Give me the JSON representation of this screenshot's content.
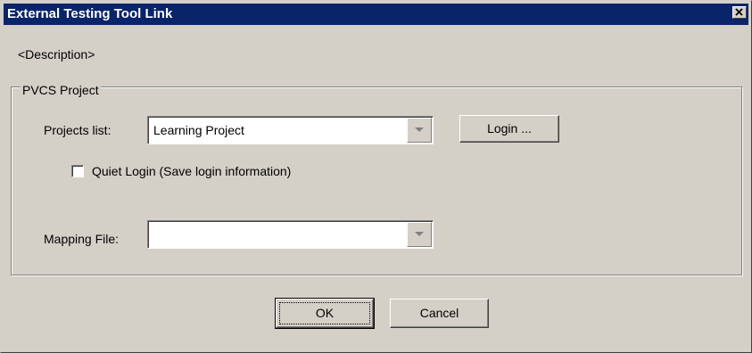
{
  "window": {
    "title": "External Testing Tool Link",
    "close_icon": "close-icon"
  },
  "description": "<Description>",
  "group": {
    "legend": "PVCS Project",
    "projects_list_label": "Projects list:",
    "projects_list_value": "Learning Project",
    "login_button": "Login ...",
    "quiet_login_label": "Quiet Login (Save login information)",
    "quiet_login_checked": false,
    "mapping_file_label": "Mapping File:",
    "mapping_file_value": ""
  },
  "buttons": {
    "ok": "OK",
    "cancel": "Cancel"
  },
  "colors": {
    "titlebar": "#0a246a",
    "dialog_face": "#d4d0c8"
  }
}
